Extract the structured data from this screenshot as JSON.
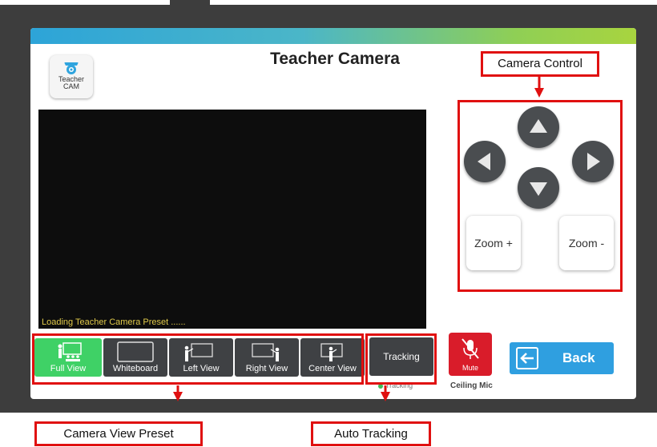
{
  "header": {
    "title": "Teacher Camera",
    "teacher_cam_line1": "Teacher",
    "teacher_cam_line2": "CAM"
  },
  "video": {
    "status_text": "Loading Teacher Camera Preset ......"
  },
  "camera_control": {
    "zoom_in_label": "Zoom +",
    "zoom_out_label": "Zoom -"
  },
  "presets": [
    {
      "label": "Full View",
      "active": true
    },
    {
      "label": "Whiteboard",
      "active": false
    },
    {
      "label": "Left View",
      "active": false
    },
    {
      "label": "Right View",
      "active": false
    },
    {
      "label": "Center View",
      "active": false
    }
  ],
  "tracking": {
    "button_label": "Tracking",
    "status_label": "Tracking"
  },
  "mic": {
    "mute_label": "Mute",
    "caption": "Ceiling Mic"
  },
  "back": {
    "label": "Back"
  },
  "annotations": {
    "camera_control": "Camera Control",
    "camera_view_preset": "Camera View Preset",
    "auto_tracking": "Auto Tracking"
  },
  "colors": {
    "frame": "#3d3d3d",
    "active_preset": "#3fd166",
    "mute_red": "#d91c2a",
    "back_blue": "#2f9fe0",
    "annotation_red": "#e01010",
    "loading_text": "#e0c94a"
  }
}
